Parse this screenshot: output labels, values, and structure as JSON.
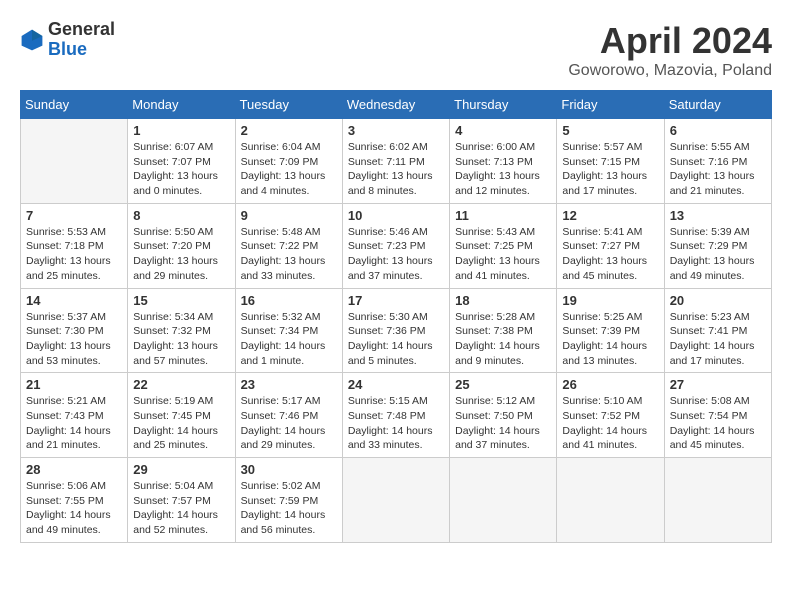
{
  "header": {
    "logo_general": "General",
    "logo_blue": "Blue",
    "title": "April 2024",
    "location": "Goworowo, Mazovia, Poland"
  },
  "calendar": {
    "days_of_week": [
      "Sunday",
      "Monday",
      "Tuesday",
      "Wednesday",
      "Thursday",
      "Friday",
      "Saturday"
    ],
    "weeks": [
      [
        {
          "day": "",
          "info": ""
        },
        {
          "day": "1",
          "info": "Sunrise: 6:07 AM\nSunset: 7:07 PM\nDaylight: 13 hours\nand 0 minutes."
        },
        {
          "day": "2",
          "info": "Sunrise: 6:04 AM\nSunset: 7:09 PM\nDaylight: 13 hours\nand 4 minutes."
        },
        {
          "day": "3",
          "info": "Sunrise: 6:02 AM\nSunset: 7:11 PM\nDaylight: 13 hours\nand 8 minutes."
        },
        {
          "day": "4",
          "info": "Sunrise: 6:00 AM\nSunset: 7:13 PM\nDaylight: 13 hours\nand 12 minutes."
        },
        {
          "day": "5",
          "info": "Sunrise: 5:57 AM\nSunset: 7:15 PM\nDaylight: 13 hours\nand 17 minutes."
        },
        {
          "day": "6",
          "info": "Sunrise: 5:55 AM\nSunset: 7:16 PM\nDaylight: 13 hours\nand 21 minutes."
        }
      ],
      [
        {
          "day": "7",
          "info": "Sunrise: 5:53 AM\nSunset: 7:18 PM\nDaylight: 13 hours\nand 25 minutes."
        },
        {
          "day": "8",
          "info": "Sunrise: 5:50 AM\nSunset: 7:20 PM\nDaylight: 13 hours\nand 29 minutes."
        },
        {
          "day": "9",
          "info": "Sunrise: 5:48 AM\nSunset: 7:22 PM\nDaylight: 13 hours\nand 33 minutes."
        },
        {
          "day": "10",
          "info": "Sunrise: 5:46 AM\nSunset: 7:23 PM\nDaylight: 13 hours\nand 37 minutes."
        },
        {
          "day": "11",
          "info": "Sunrise: 5:43 AM\nSunset: 7:25 PM\nDaylight: 13 hours\nand 41 minutes."
        },
        {
          "day": "12",
          "info": "Sunrise: 5:41 AM\nSunset: 7:27 PM\nDaylight: 13 hours\nand 45 minutes."
        },
        {
          "day": "13",
          "info": "Sunrise: 5:39 AM\nSunset: 7:29 PM\nDaylight: 13 hours\nand 49 minutes."
        }
      ],
      [
        {
          "day": "14",
          "info": "Sunrise: 5:37 AM\nSunset: 7:30 PM\nDaylight: 13 hours\nand 53 minutes."
        },
        {
          "day": "15",
          "info": "Sunrise: 5:34 AM\nSunset: 7:32 PM\nDaylight: 13 hours\nand 57 minutes."
        },
        {
          "day": "16",
          "info": "Sunrise: 5:32 AM\nSunset: 7:34 PM\nDaylight: 14 hours\nand 1 minute."
        },
        {
          "day": "17",
          "info": "Sunrise: 5:30 AM\nSunset: 7:36 PM\nDaylight: 14 hours\nand 5 minutes."
        },
        {
          "day": "18",
          "info": "Sunrise: 5:28 AM\nSunset: 7:38 PM\nDaylight: 14 hours\nand 9 minutes."
        },
        {
          "day": "19",
          "info": "Sunrise: 5:25 AM\nSunset: 7:39 PM\nDaylight: 14 hours\nand 13 minutes."
        },
        {
          "day": "20",
          "info": "Sunrise: 5:23 AM\nSunset: 7:41 PM\nDaylight: 14 hours\nand 17 minutes."
        }
      ],
      [
        {
          "day": "21",
          "info": "Sunrise: 5:21 AM\nSunset: 7:43 PM\nDaylight: 14 hours\nand 21 minutes."
        },
        {
          "day": "22",
          "info": "Sunrise: 5:19 AM\nSunset: 7:45 PM\nDaylight: 14 hours\nand 25 minutes."
        },
        {
          "day": "23",
          "info": "Sunrise: 5:17 AM\nSunset: 7:46 PM\nDaylight: 14 hours\nand 29 minutes."
        },
        {
          "day": "24",
          "info": "Sunrise: 5:15 AM\nSunset: 7:48 PM\nDaylight: 14 hours\nand 33 minutes."
        },
        {
          "day": "25",
          "info": "Sunrise: 5:12 AM\nSunset: 7:50 PM\nDaylight: 14 hours\nand 37 minutes."
        },
        {
          "day": "26",
          "info": "Sunrise: 5:10 AM\nSunset: 7:52 PM\nDaylight: 14 hours\nand 41 minutes."
        },
        {
          "day": "27",
          "info": "Sunrise: 5:08 AM\nSunset: 7:54 PM\nDaylight: 14 hours\nand 45 minutes."
        }
      ],
      [
        {
          "day": "28",
          "info": "Sunrise: 5:06 AM\nSunset: 7:55 PM\nDaylight: 14 hours\nand 49 minutes."
        },
        {
          "day": "29",
          "info": "Sunrise: 5:04 AM\nSunset: 7:57 PM\nDaylight: 14 hours\nand 52 minutes."
        },
        {
          "day": "30",
          "info": "Sunrise: 5:02 AM\nSunset: 7:59 PM\nDaylight: 14 hours\nand 56 minutes."
        },
        {
          "day": "",
          "info": ""
        },
        {
          "day": "",
          "info": ""
        },
        {
          "day": "",
          "info": ""
        },
        {
          "day": "",
          "info": ""
        }
      ]
    ]
  }
}
